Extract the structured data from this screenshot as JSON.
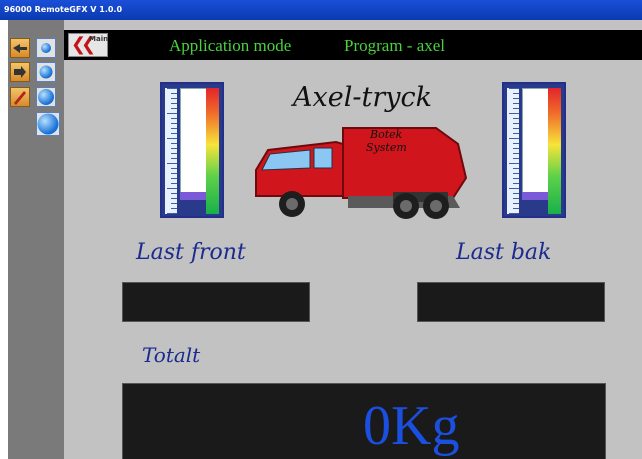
{
  "titlebar": {
    "title": "96000 RemoteGFX V 1.0.0"
  },
  "toolbar": {
    "rows": [
      {
        "icon": "hand-arrow-icon"
      },
      {
        "icon": "hand-pointer-icon"
      },
      {
        "icon": "pen-icon"
      }
    ]
  },
  "header": {
    "back_label": "Main",
    "mode_label": "Application mode",
    "program_label": "Program - axel"
  },
  "logo": {
    "title": "Axel-tryck",
    "brand_line1": "Botek",
    "brand_line2": "System"
  },
  "gauges": {
    "front_level": 0.07,
    "rear_level": 0.07
  },
  "fields": {
    "front_label": "Last front",
    "rear_label": "Last bak",
    "total_label": "Totalt",
    "front_value": "",
    "rear_value": "",
    "total_value": "0Kg"
  },
  "colors": {
    "header_text": "#49d23d",
    "total_value": "#1b4fe0",
    "script_text": "#1b2a8f"
  }
}
